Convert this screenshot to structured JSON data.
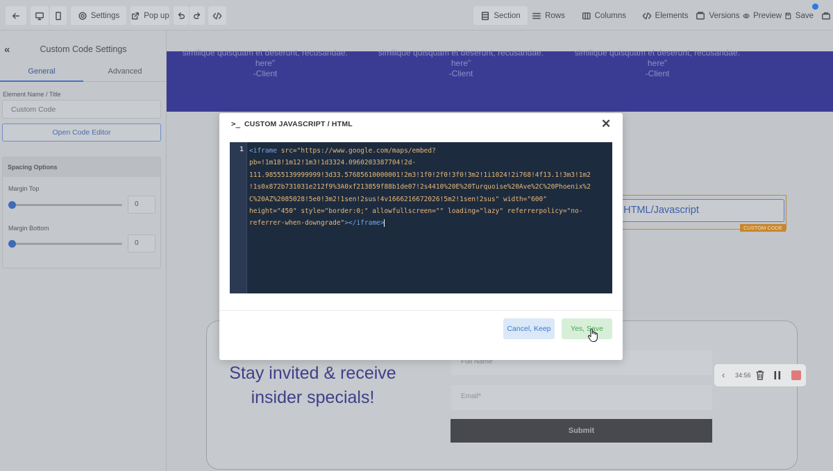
{
  "toolbar": {
    "settings_label": "Settings",
    "popup_label": "Pop up",
    "section_label": "Section",
    "rows_label": "Rows",
    "columns_label": "Columns",
    "elements_label": "Elements",
    "versions_label": "Versions",
    "preview_label": "Preview",
    "save_label": "Save"
  },
  "left_panel": {
    "title": "Custom Code Settings",
    "tabs": [
      "General",
      "Advanced"
    ],
    "element_name_label": "Element Name / Title",
    "element_name_value": "Custom Code",
    "open_code_editor_label": "Open Code Editor",
    "spacing": {
      "title": "Spacing Options",
      "margin_top_label": "Margin Top",
      "margin_top_value": "0",
      "margin_bottom_label": "Margin Bottom",
      "margin_bottom_value": "0"
    }
  },
  "canvas": {
    "testimonials": [
      {
        "line1": "similique quisquam et deserunt, recusandae.",
        "line2": "here\"",
        "line3": "-Client"
      },
      {
        "line1": "similique quisquam et deserunt, recusandae.",
        "line2": "here\"",
        "line3": "-Client"
      },
      {
        "line1": "similique quisquam et deserunt, recusandae.",
        "line2": "here\"",
        "line3": "-Client"
      }
    ],
    "selected_element_text": "n HTML/Javascript",
    "selected_element_tag": "CUSTOM CODE",
    "signup": {
      "heading": "Stay invited & receive insider specials!",
      "full_name_placeholder": "Full Name",
      "email_placeholder": "Email*",
      "submit_label": "Submit"
    }
  },
  "recorder": {
    "time": "34:56"
  },
  "modal": {
    "prompt_symbol": ">_",
    "title": "CUSTOM JAVASCRIPT / HTML",
    "line_number": "1",
    "code": {
      "l1_tag": "<iframe",
      "l1_attr": " src=",
      "l1_str": "\"https://www.google.com/maps/embed?",
      "l2": "pb=!1m18!1m12!1m3!1d3324.0960203387704!2d-",
      "l3": "111.98555139999999!3d33.57685610000001!2m3!1f0!2f0!3f0!3m2!1i1024!2i768!4f13.1!3m3!1m2",
      "l4": "!1s0x872b731031e212f9%3A0xf213859f88b1de07!2s4410%20E%20Turquoise%20Ave%2C%20Phoenix%2",
      "l5": "C%20AZ%2085028!5e0!3m2!1sen!2sus!4v1666216672026!5m2!1sen!2sus\" width=\"600\"",
      "l6": "height=\"450\" style=\"border:0;\" allowfullscreen=\"\" loading=\"lazy\" referrerpolicy=\"no-",
      "l7_str": "referrer-when-downgrade\"",
      "l7_tag": "></iframe>"
    },
    "cancel_label": "Cancel, Keep",
    "save_label": "Yes, Save"
  }
}
